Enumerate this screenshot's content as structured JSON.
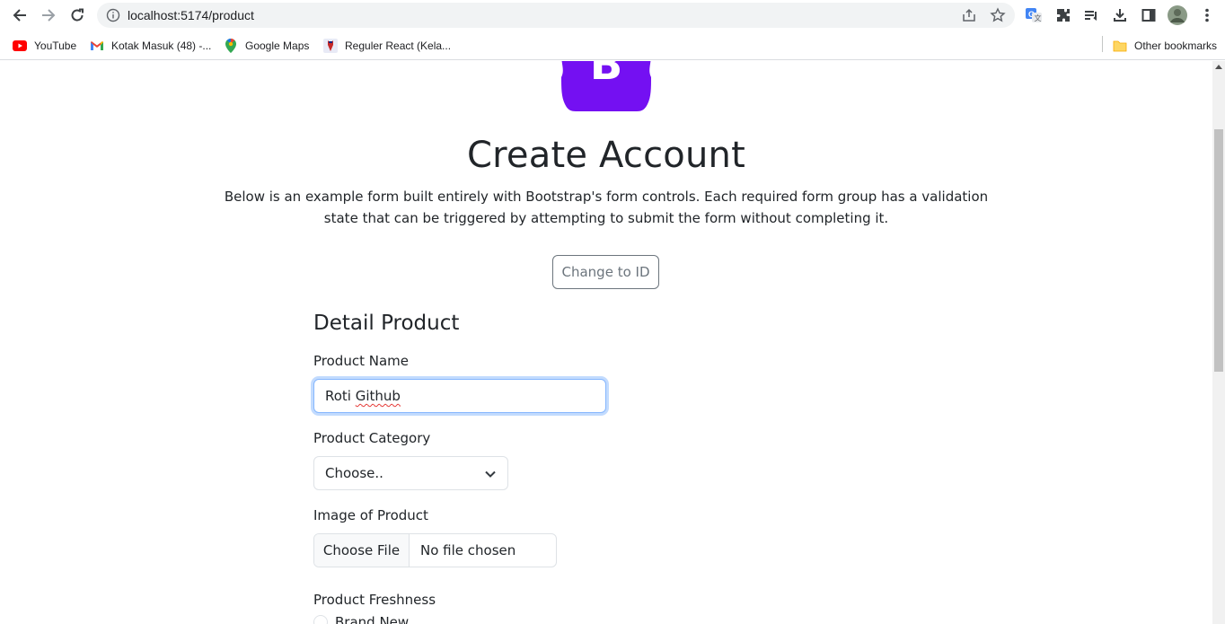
{
  "browser": {
    "url": "localhost:5174/product",
    "bookmarks": [
      {
        "label": "YouTube",
        "icon": "youtube-icon"
      },
      {
        "label": "Kotak Masuk (48) -...",
        "icon": "gmail-icon"
      },
      {
        "label": "Google Maps",
        "icon": "maps-icon"
      },
      {
        "label": "Reguler React (Kela...",
        "icon": "react-course-icon"
      }
    ],
    "other_bookmarks": "Other bookmarks"
  },
  "header": {
    "logo_letter": "B",
    "title": "Create Account",
    "lead": "Below is an example form built entirely with Bootstrap's form controls. Each required form group has a validation state that can be triggered by attempting to submit the form without completing it.",
    "language_button": "Change to ID"
  },
  "form": {
    "section_title": "Detail Product",
    "product_name_label": "Product Name",
    "product_name_first": "Roti ",
    "product_name_second": "Github",
    "category_label": "Product Category",
    "category_selected": "Choose..",
    "image_label": "Image of Product",
    "file_button": "Choose File",
    "file_status": "No file chosen",
    "freshness_label": "Product Freshness",
    "freshness_option_1": "Brand New"
  },
  "colors": {
    "brand_purple": "#7952b3",
    "focus_border": "#86b7fe"
  }
}
